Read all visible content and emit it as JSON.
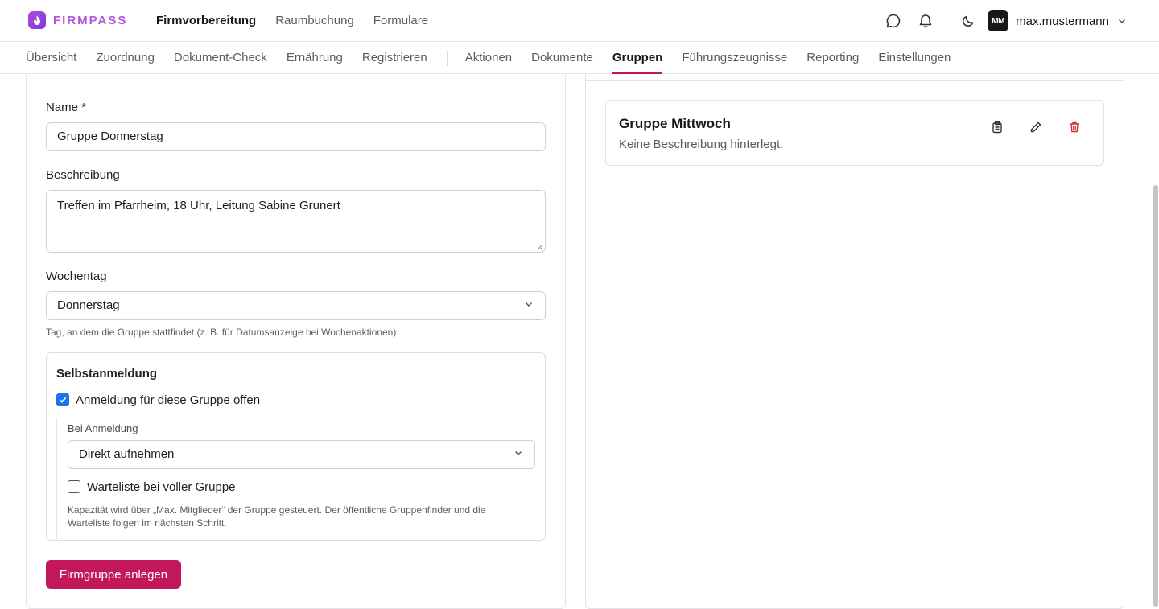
{
  "brand": {
    "name": "FIRMPASS",
    "accent": "#b157d8"
  },
  "topnav": [
    "Firmvorbereitung",
    "Raumbuchung",
    "Formulare"
  ],
  "user": {
    "initials": "MM",
    "name": "max.mustermann"
  },
  "subnav": {
    "group1": [
      "Übersicht",
      "Zuordnung",
      "Dokument-Check",
      "Ernährung",
      "Registrieren"
    ],
    "group2": [
      "Aktionen",
      "Dokumente",
      "Gruppen",
      "Führungszeugnisse",
      "Reporting",
      "Einstellungen"
    ],
    "active": "Gruppen"
  },
  "form": {
    "name_label": "Name *",
    "name_value": "Gruppe Donnerstag",
    "desc_label": "Beschreibung",
    "desc_value": "Treffen im Pfarrheim, 18 Uhr, Leitung Sabine Grunert",
    "weekday_label": "Wochentag",
    "weekday_value": "Donnerstag",
    "weekday_hint": "Tag, an dem die Gruppe stattfindet (z. B. für Datumsanzeige bei Wochenaktionen).",
    "self": {
      "title": "Selbstanmeldung",
      "open_label": "Anmeldung für diese Gruppe offen",
      "open_checked": true,
      "on_signup_label": "Bei Anmeldung",
      "on_signup_value": "Direkt aufnehmen",
      "waitlist_label": "Warteliste bei voller Gruppe",
      "waitlist_checked": false,
      "hint_line1": "Kapazität wird über „Max. Mitglieder“ der Gruppe gesteuert. Der öffentliche Gruppenfinder und die",
      "hint_line2": "Warteliste folgen im nächsten Schritt."
    },
    "submit_label": "Firmgruppe anlegen"
  },
  "groups": [
    {
      "title": "Gruppe Mittwoch",
      "description": "Keine Beschreibung hinterlegt."
    }
  ]
}
